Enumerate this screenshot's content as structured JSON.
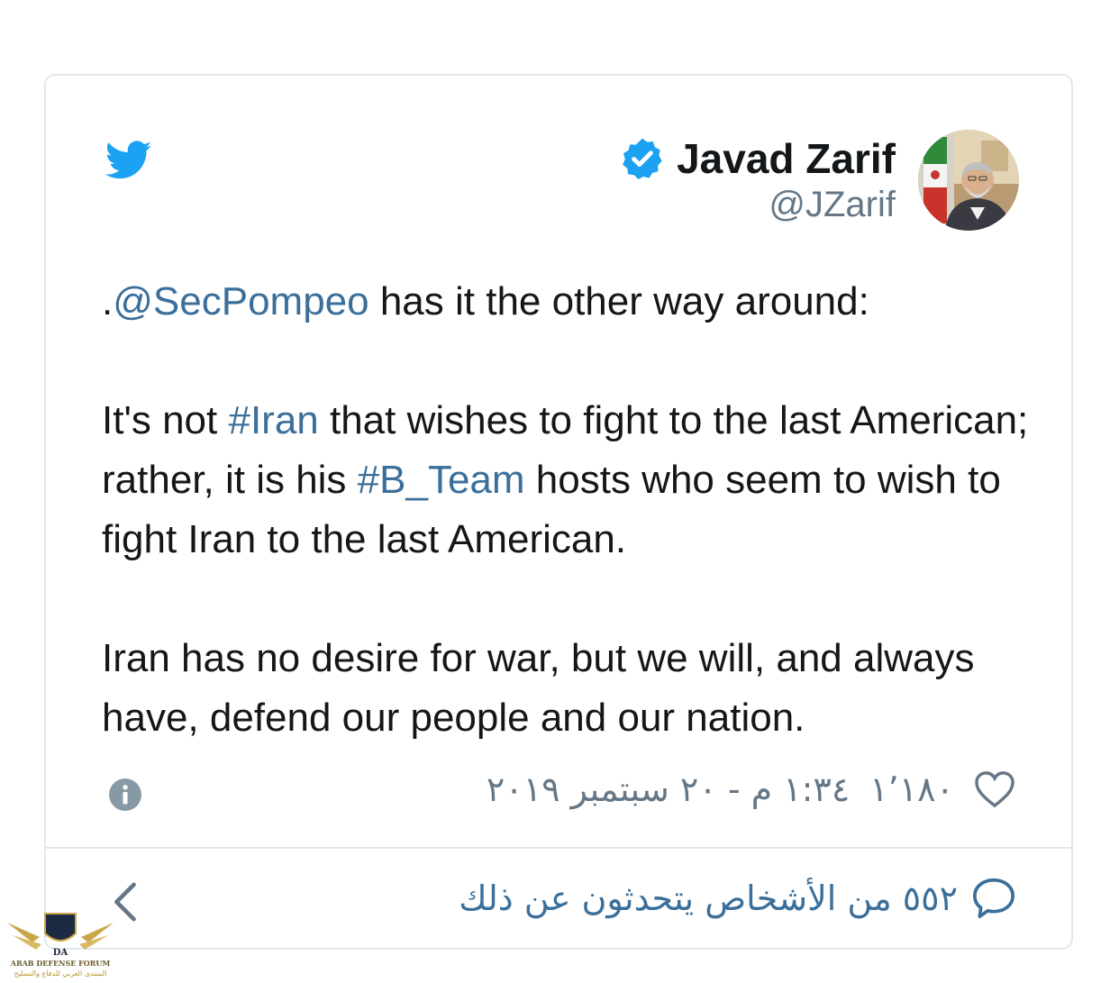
{
  "author": {
    "name": "Javad Zarif",
    "handle": "@JZarif",
    "verified": true,
    "avatar": "avatar-photo"
  },
  "tweet": {
    "line1_prefix": ".",
    "line1_mention": "@SecPompeo",
    "line1_rest": " has it the other way around:",
    "p2_a": "It's not ",
    "p2_hashtag1": "#Iran",
    "p2_b": " that wishes to fight to the last American; rather, it is his ",
    "p2_hashtag2": "#B_Team",
    "p2_c": " hosts who seem to wish to fight Iran to the last American.",
    "p3": "Iran has no desire for war, but we will, and always have, defend our people and our nation."
  },
  "meta": {
    "date": "١:٣٤ م - ٢٠ سبتمبر ٢٠١٩",
    "likes": "١٬١٨٠",
    "info_icon": "info-icon",
    "heart_icon": "heart-icon"
  },
  "footer": {
    "people_talking": "٥٥٢ من الأشخاص يتحدثون عن ذلك",
    "bubble_icon": "speech-bubble-icon",
    "chevron_icon": "chevron-left-icon"
  },
  "watermark": {
    "line1": "ARAB DEFENSE FORUM",
    "line2": "المنتدى العربي للدفاع والتسليح",
    "logo_text": "DA"
  },
  "colors": {
    "twitter_blue": "#1da1f2",
    "link": "#3b6f9a",
    "secondary_text": "#657786",
    "border": "#e1e8ed"
  }
}
